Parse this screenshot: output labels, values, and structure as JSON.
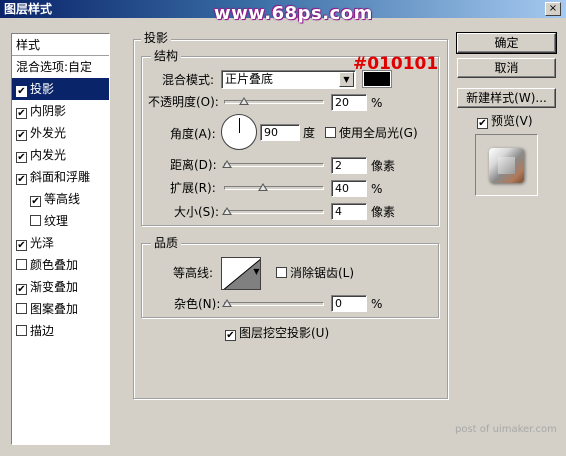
{
  "window": {
    "title": "图层样式",
    "close_label": "×"
  },
  "watermark": "www.68ps.com",
  "annotation": "#010101",
  "sidebar": {
    "header": "样式",
    "blend_options": "混合选项:自定",
    "items": [
      {
        "label": "投影",
        "checked": true,
        "selected": true,
        "indent": false
      },
      {
        "label": "内阴影",
        "checked": true,
        "selected": false,
        "indent": false
      },
      {
        "label": "外发光",
        "checked": true,
        "selected": false,
        "indent": false
      },
      {
        "label": "内发光",
        "checked": true,
        "selected": false,
        "indent": false
      },
      {
        "label": "斜面和浮雕",
        "checked": true,
        "selected": false,
        "indent": false
      },
      {
        "label": "等高线",
        "checked": true,
        "selected": false,
        "indent": true
      },
      {
        "label": "纹理",
        "checked": false,
        "selected": false,
        "indent": true
      },
      {
        "label": "光泽",
        "checked": true,
        "selected": false,
        "indent": false
      },
      {
        "label": "颜色叠加",
        "checked": false,
        "selected": false,
        "indent": false
      },
      {
        "label": "渐变叠加",
        "checked": true,
        "selected": false,
        "indent": false
      },
      {
        "label": "图案叠加",
        "checked": false,
        "selected": false,
        "indent": false
      },
      {
        "label": "描边",
        "checked": false,
        "selected": false,
        "indent": false
      }
    ]
  },
  "panel": {
    "title": "投影",
    "structure": {
      "title": "结构",
      "blend_mode_label": "混合模式:",
      "blend_mode_value": "正片叠底",
      "blend_color": "#010101",
      "opacity_label": "不透明度(O):",
      "opacity_value": "20",
      "opacity_level": 20,
      "percent": "%",
      "angle_label": "角度(A):",
      "angle_value": "90",
      "angle_unit": "度",
      "global_light_label": "使用全局光(G)",
      "global_light_checked": false,
      "distance_label": "距离(D):",
      "distance_value": "2",
      "distance_unit": "像素",
      "spread_label": "扩展(R):",
      "spread_value": "40",
      "spread_unit": "%",
      "size_label": "大小(S):",
      "size_value": "4",
      "size_unit": "像素"
    },
    "quality": {
      "title": "品质",
      "contour_label": "等高线:",
      "antialias_label": "消除锯齿(L)",
      "antialias_checked": false,
      "noise_label": "杂色(N):",
      "noise_value": "0",
      "noise_unit": "%"
    },
    "knockout_label": "图层挖空投影(U)",
    "knockout_checked": true
  },
  "buttons": {
    "ok": "确定",
    "cancel": "取消",
    "new_style": "新建样式(W)...",
    "preview_label": "预览(V)",
    "preview_checked": true
  },
  "footer_mark": "post of uimaker.com"
}
